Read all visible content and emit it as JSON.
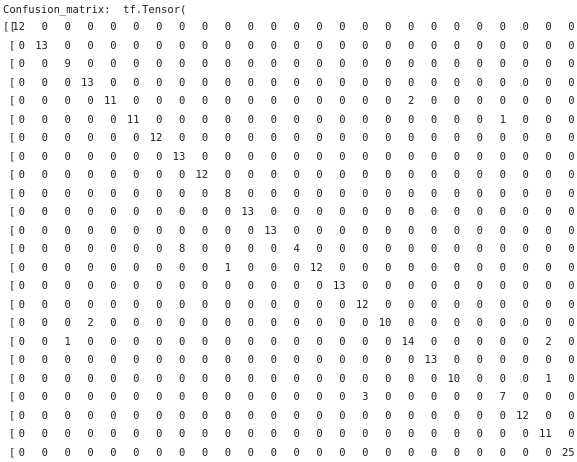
{
  "output": {
    "label": "Confusion_matrix:",
    "tensor_prefix": "tf.Tensor("
  },
  "matrix": [
    [
      12,
      0,
      0,
      0,
      0,
      0,
      0,
      0,
      0,
      0,
      0,
      0,
      0,
      0,
      0,
      0,
      0,
      0,
      0,
      0,
      0,
      0,
      0,
      0,
      0
    ],
    [
      0,
      13,
      0,
      0,
      0,
      0,
      0,
      0,
      0,
      0,
      0,
      0,
      0,
      0,
      0,
      0,
      0,
      0,
      0,
      0,
      0,
      0,
      0,
      0,
      0
    ],
    [
      0,
      0,
      9,
      0,
      0,
      0,
      0,
      0,
      0,
      0,
      0,
      0,
      0,
      0,
      0,
      0,
      0,
      0,
      0,
      0,
      0,
      0,
      0,
      0,
      0
    ],
    [
      0,
      0,
      0,
      13,
      0,
      0,
      0,
      0,
      0,
      0,
      0,
      0,
      0,
      0,
      0,
      0,
      0,
      0,
      0,
      0,
      0,
      0,
      0,
      0,
      0
    ],
    [
      0,
      0,
      0,
      0,
      11,
      0,
      0,
      0,
      0,
      0,
      0,
      0,
      0,
      0,
      0,
      0,
      0,
      2,
      0,
      0,
      0,
      0,
      0,
      0,
      0
    ],
    [
      0,
      0,
      0,
      0,
      0,
      11,
      0,
      0,
      0,
      0,
      0,
      0,
      0,
      0,
      0,
      0,
      0,
      0,
      0,
      0,
      0,
      1,
      0,
      0,
      0
    ],
    [
      0,
      0,
      0,
      0,
      0,
      0,
      12,
      0,
      0,
      0,
      0,
      0,
      0,
      0,
      0,
      0,
      0,
      0,
      0,
      0,
      0,
      0,
      0,
      0,
      0
    ],
    [
      0,
      0,
      0,
      0,
      0,
      0,
      0,
      13,
      0,
      0,
      0,
      0,
      0,
      0,
      0,
      0,
      0,
      0,
      0,
      0,
      0,
      0,
      0,
      0,
      0
    ],
    [
      0,
      0,
      0,
      0,
      0,
      0,
      0,
      0,
      12,
      0,
      0,
      0,
      0,
      0,
      0,
      0,
      0,
      0,
      0,
      0,
      0,
      0,
      0,
      0,
      0
    ],
    [
      0,
      0,
      0,
      0,
      0,
      0,
      0,
      0,
      0,
      8,
      0,
      0,
      0,
      0,
      0,
      0,
      0,
      0,
      0,
      0,
      0,
      0,
      0,
      0,
      0
    ],
    [
      0,
      0,
      0,
      0,
      0,
      0,
      0,
      0,
      0,
      0,
      13,
      0,
      0,
      0,
      0,
      0,
      0,
      0,
      0,
      0,
      0,
      0,
      0,
      0,
      0
    ],
    [
      0,
      0,
      0,
      0,
      0,
      0,
      0,
      0,
      0,
      0,
      0,
      13,
      0,
      0,
      0,
      0,
      0,
      0,
      0,
      0,
      0,
      0,
      0,
      0,
      0
    ],
    [
      0,
      0,
      0,
      0,
      0,
      0,
      0,
      8,
      0,
      0,
      0,
      0,
      4,
      0,
      0,
      0,
      0,
      0,
      0,
      0,
      0,
      0,
      0,
      0,
      0
    ],
    [
      0,
      0,
      0,
      0,
      0,
      0,
      0,
      0,
      0,
      1,
      0,
      0,
      0,
      12,
      0,
      0,
      0,
      0,
      0,
      0,
      0,
      0,
      0,
      0,
      0
    ],
    [
      0,
      0,
      0,
      0,
      0,
      0,
      0,
      0,
      0,
      0,
      0,
      0,
      0,
      0,
      13,
      0,
      0,
      0,
      0,
      0,
      0,
      0,
      0,
      0,
      0
    ],
    [
      0,
      0,
      0,
      0,
      0,
      0,
      0,
      0,
      0,
      0,
      0,
      0,
      0,
      0,
      0,
      12,
      0,
      0,
      0,
      0,
      0,
      0,
      0,
      0,
      0
    ],
    [
      0,
      0,
      0,
      2,
      0,
      0,
      0,
      0,
      0,
      0,
      0,
      0,
      0,
      0,
      0,
      0,
      10,
      0,
      0,
      0,
      0,
      0,
      0,
      0,
      0
    ],
    [
      0,
      0,
      1,
      0,
      0,
      0,
      0,
      0,
      0,
      0,
      0,
      0,
      0,
      0,
      0,
      0,
      0,
      14,
      0,
      0,
      0,
      0,
      0,
      2,
      0
    ],
    [
      0,
      0,
      0,
      0,
      0,
      0,
      0,
      0,
      0,
      0,
      0,
      0,
      0,
      0,
      0,
      0,
      0,
      0,
      13,
      0,
      0,
      0,
      0,
      0,
      0
    ],
    [
      0,
      0,
      0,
      0,
      0,
      0,
      0,
      0,
      0,
      0,
      0,
      0,
      0,
      0,
      0,
      0,
      0,
      0,
      0,
      10,
      0,
      0,
      0,
      1,
      0
    ],
    [
      0,
      0,
      0,
      0,
      0,
      0,
      0,
      0,
      0,
      0,
      0,
      0,
      0,
      0,
      0,
      3,
      0,
      0,
      0,
      0,
      0,
      7,
      0,
      0,
      0
    ],
    [
      0,
      0,
      0,
      0,
      0,
      0,
      0,
      0,
      0,
      0,
      0,
      0,
      0,
      0,
      0,
      0,
      0,
      0,
      0,
      0,
      0,
      0,
      12,
      0,
      0
    ],
    [
      0,
      0,
      0,
      0,
      0,
      0,
      0,
      0,
      0,
      0,
      0,
      0,
      0,
      0,
      0,
      0,
      0,
      0,
      0,
      0,
      0,
      0,
      0,
      11,
      0
    ],
    [
      0,
      0,
      0,
      0,
      0,
      0,
      0,
      0,
      0,
      0,
      0,
      0,
      0,
      0,
      0,
      0,
      0,
      0,
      0,
      0,
      0,
      0,
      0,
      0,
      25
    ]
  ]
}
